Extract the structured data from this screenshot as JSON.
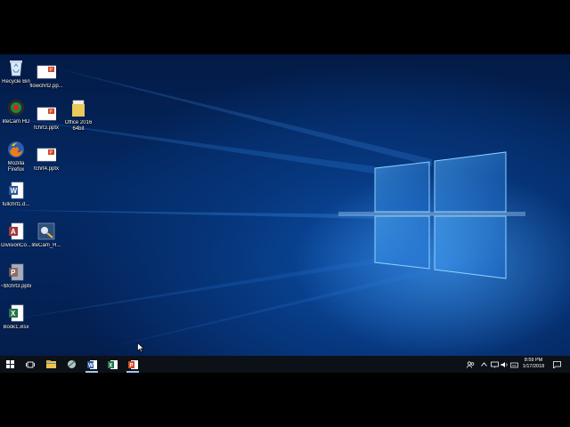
{
  "desktop_icons": [
    {
      "label": "Recycle Bin",
      "icon": "recycle-bin-icon"
    },
    {
      "label": "flowchrt2.pp...",
      "icon": "powerpoint-file-icon"
    },
    {
      "label": "liteCam HD",
      "icon": "litecam-icon"
    },
    {
      "label": "fchrt3.pptx",
      "icon": "powerpoint-file-icon"
    },
    {
      "label": "Office 2016 64bit",
      "icon": "folder-icon"
    },
    {
      "label": "Mozilla Firefox",
      "icon": "firefox-icon"
    },
    {
      "label": "fchrt4.pptx",
      "icon": "powerpoint-file-icon"
    },
    {
      "label": "fullchrt1.d...",
      "icon": "word-file-icon"
    },
    {
      "label": "DivisionCo...",
      "icon": "access-file-icon"
    },
    {
      "label": "liteCam_H...",
      "icon": "installer-icon"
    },
    {
      "label": "~$fchrt3.pptx",
      "icon": "temp-powerpoint-file-icon"
    },
    {
      "label": "Book1.xlsx",
      "icon": "excel-file-icon"
    }
  ],
  "taskbar": {
    "pinned": [
      "start-button",
      "task-view-button",
      "file-explorer",
      "app-button",
      "word",
      "excel",
      "powerpoint"
    ],
    "active": [
      "word",
      "powerpoint"
    ]
  },
  "tray": {
    "time": "8:59 PM",
    "date": "1/17/2018"
  },
  "colors": {
    "taskbar": "#0c1118",
    "wallpaper_blue": "#0b4ea6",
    "word": "#2b579a",
    "excel": "#217346",
    "powerpoint": "#d24726"
  }
}
